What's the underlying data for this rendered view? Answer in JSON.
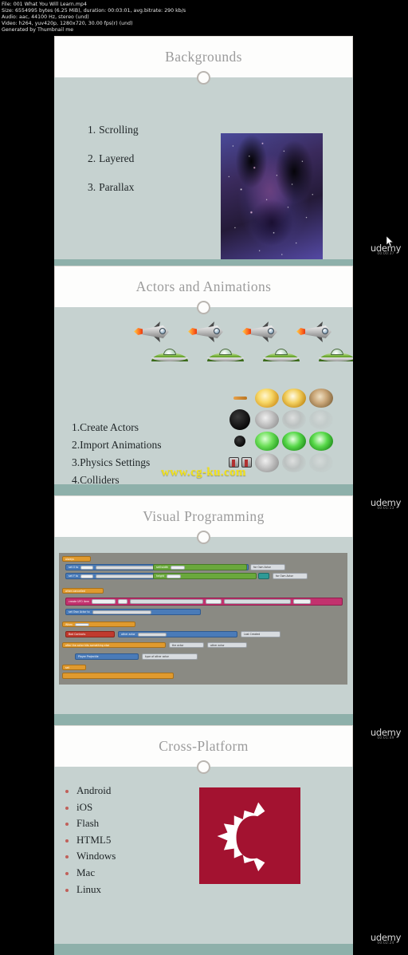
{
  "meta": {
    "lines": [
      "File: 001 What You Will Learn.mp4",
      "Size: 6554995 bytes (6.25 MiB), duration: 00:03:01, avg.bitrate: 290 kb/s",
      "Audio: aac, 44100 Hz, stereo (und)",
      "Video: h264, yuv420p, 1280x720, 30.00 fps(r) (und)",
      "Generated by Thumbnail me"
    ]
  },
  "slides": [
    {
      "title": "Backgrounds",
      "list": [
        {
          "n": "1.",
          "text": "Scrolling"
        },
        {
          "n": "2.",
          "text": "Layered"
        },
        {
          "n": "3.",
          "text": "Parallax"
        }
      ],
      "image_name": "nebula-starfield-background"
    },
    {
      "title": "Actors and Animations",
      "list": [
        {
          "n": "1.",
          "text": "Create Actors"
        },
        {
          "n": "2.",
          "text": "Import Animations"
        },
        {
          "n": "3.",
          "text": "Physics Settings"
        },
        {
          "n": "4.",
          "text": "Colliders"
        }
      ],
      "watermark": "www.cg-ku.com"
    },
    {
      "title": "Visual Programming",
      "blocks": [
        "always",
        "set X to",
        "self.width",
        "self",
        "for Own Actor",
        "set Y to",
        "height",
        "when cancelled",
        "create UFO Item",
        "at",
        "self.width",
        "self",
        "set Own Actor to",
        "Last Created Actor",
        "When",
        "self",
        "killed",
        "Bad Contacts",
        "other actor",
        "Last Created",
        "after the actor hits something else",
        "the actor",
        "other actor",
        "Player Projectile",
        "type of other actor",
        "set"
      ]
    },
    {
      "title": "Cross-Platform",
      "list": [
        "Android",
        "iOS",
        "Flash",
        "HTML5",
        "Windows",
        "Mac",
        "Linux"
      ],
      "logo_name": "construct-logo"
    }
  ],
  "watermarks": [
    {
      "word": "udemy",
      "sub": "00:00:37"
    },
    {
      "word": "udemy",
      "sub": "00:01:13"
    },
    {
      "word": "udemy",
      "sub": "00:01:49"
    },
    {
      "word": "udemy",
      "sub": "00:02:24"
    }
  ],
  "colors": {
    "slide_body": "#c6d2d0",
    "slide_footer": "#8eb0aa",
    "title_text": "#9b9b9b",
    "bullet": "#c0605a",
    "logo_red": "#a31230",
    "watermark_yellow": "#f2e21c"
  }
}
